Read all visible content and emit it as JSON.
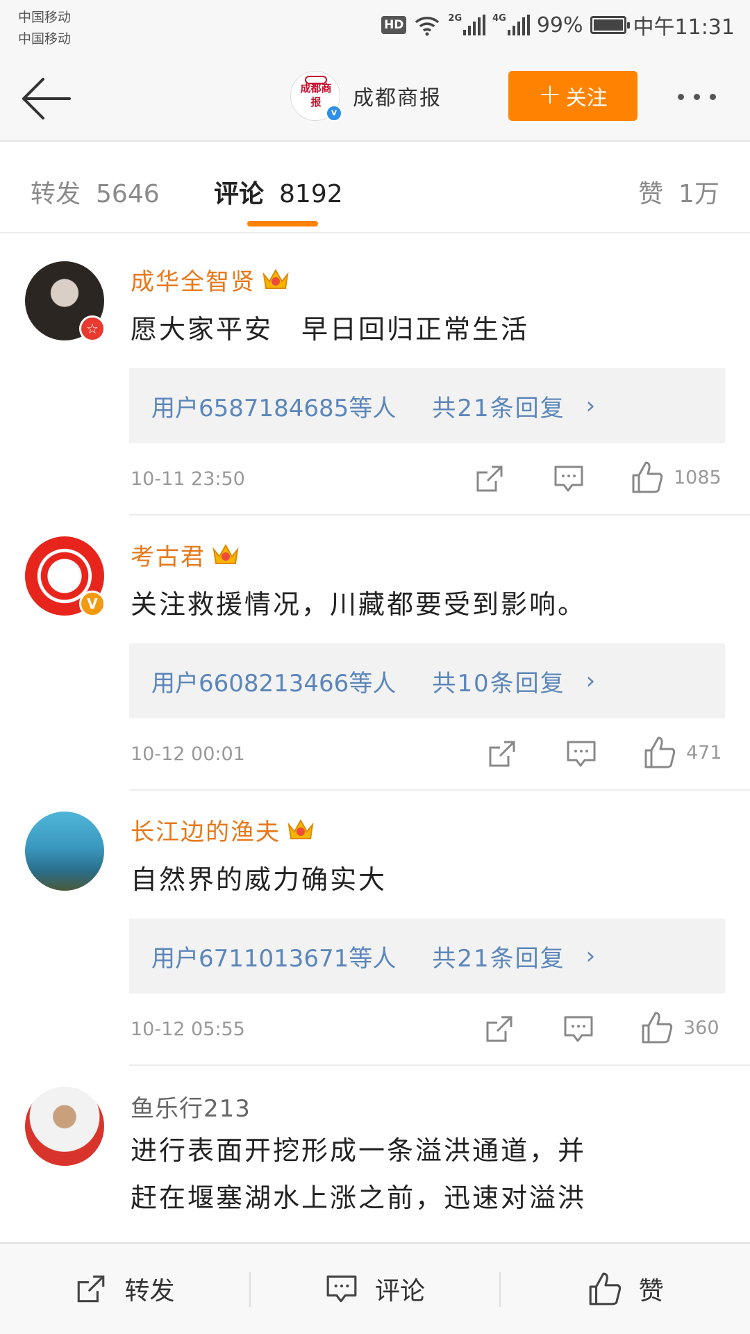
{
  "status_bar": {
    "carrier_1": "中国移动",
    "carrier_2": "中国移动",
    "hd": "HD",
    "net_2g": "2G",
    "net_4g": "4G",
    "battery": "99%",
    "time": "中午11:31"
  },
  "header": {
    "account_name": "成都商报",
    "avatar_logo_text": "成都商报",
    "verified_badge": "v",
    "follow_label": "关注",
    "follow_plus": "+",
    "follow_color": "#ff8200"
  },
  "tabs": {
    "repost_label": "转发",
    "repost_count": "5646",
    "comment_label": "评论",
    "comment_count": "8192",
    "like_label": "赞",
    "like_count": "1万",
    "active": "comment"
  },
  "comments": [
    {
      "username": "成华全智贤",
      "text": "愿大家平安　早日回归正常生活",
      "reply_users": "用户6587184685等人",
      "reply_count": "共21条回复",
      "reply_arrow": "›",
      "time": "10-11  23:50",
      "likes": "1085",
      "avatar_badge": "☆",
      "avatar_badge_color": "#e83a2f",
      "crown_level": "6"
    },
    {
      "username": "考古君",
      "text": "关注救援情况，川藏都要受到影响。",
      "reply_users": "用户6608213466等人",
      "reply_count": "共10条回复",
      "reply_arrow": "›",
      "time": "10-12  00:01",
      "likes": "471",
      "avatar_badge": "V",
      "avatar_badge_color": "#f29a10",
      "crown_level": "5"
    },
    {
      "username": "长江边的渔夫",
      "text": "自然界的威力确实大",
      "reply_users": "用户6711013671等人",
      "reply_count": "共21条回复",
      "reply_arrow": "›",
      "time": "10-12  05:55",
      "likes": "360",
      "crown_level": "4"
    },
    {
      "username": "鱼乐行213",
      "text_line_1": "进行表面开挖形成一条溢洪通道，并",
      "text_line_2": "赶在堰塞湖水上涨之前，迅速对溢洪"
    }
  ],
  "bottom_bar": {
    "repost_label": "转发",
    "comment_label": "评论",
    "like_label": "赞"
  },
  "colors": {
    "accent_orange": "#ff8200",
    "username_orange": "#e8781a",
    "link_blue": "#5b86ba"
  },
  "icons": [
    "back-arrow-icon",
    "more-dots-icon",
    "share-icon",
    "comment-icon",
    "like-thumb-icon",
    "crown-icon"
  ]
}
